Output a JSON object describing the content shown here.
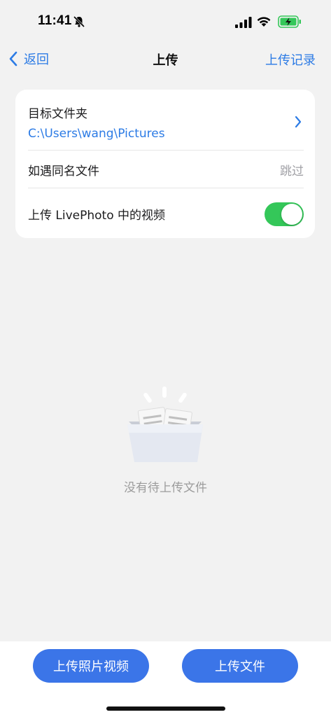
{
  "status_bar": {
    "time": "11:41",
    "icons": [
      "bell-slash-icon",
      "cellular-signal-icon",
      "wifi-icon",
      "battery-charging-icon"
    ],
    "battery_color": "#34c759"
  },
  "nav": {
    "back_label": "返回",
    "title": "上传",
    "action_label": "上传记录"
  },
  "settings": {
    "target_folder_label": "目标文件夹",
    "target_folder_path": "C:\\Users\\wang\\Pictures",
    "duplicate_label": "如遇同名文件",
    "duplicate_value": "跳过",
    "livephoto_label": "上传 LivePhoto 中的视频",
    "livephoto_enabled": true
  },
  "empty_state": {
    "text": "没有待上传文件",
    "icon": "empty-box-icon"
  },
  "buttons": {
    "upload_photos_label": "上传照片视频",
    "upload_files_label": "上传文件"
  },
  "colors": {
    "accent": "#2c7be5",
    "button": "#3b75e8",
    "toggle_on": "#34c759",
    "background": "#f2f2f2"
  }
}
